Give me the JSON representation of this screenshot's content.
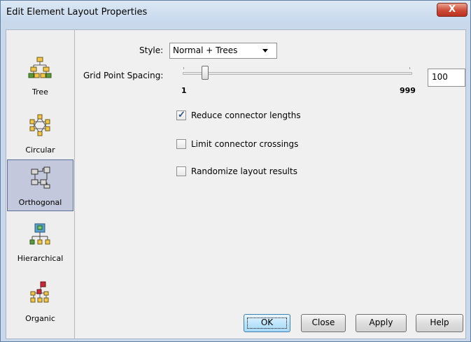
{
  "window": {
    "title": "Edit Element Layout Properties",
    "close_label": "X"
  },
  "sidebar": {
    "items": [
      {
        "label": "Tree",
        "icon": "tree-layout-icon"
      },
      {
        "label": "Circular",
        "icon": "circular-layout-icon"
      },
      {
        "label": "Orthogonal",
        "icon": "orthogonal-layout-icon",
        "selected": true
      },
      {
        "label": "Hierarchical",
        "icon": "hierarchical-layout-icon"
      },
      {
        "label": "Organic",
        "icon": "organic-layout-icon"
      }
    ]
  },
  "form": {
    "style_label": "Style:",
    "style_value": "Normal + Trees",
    "grid_label": "Grid Point Spacing:",
    "slider_min": "1",
    "slider_max": "999",
    "slider_value_fraction": 0.03,
    "grid_value": "100",
    "options": [
      {
        "label": "Reduce connector lengths",
        "checked": true
      },
      {
        "label": "Limit connector crossings",
        "checked": false
      },
      {
        "label": "Randomize layout results",
        "checked": false
      }
    ]
  },
  "buttons": {
    "ok": "OK",
    "close": "Close",
    "apply": "Apply",
    "help": "Help"
  },
  "colors": {
    "selected_bg": "#c4c8dc",
    "close_red": "#cc4a36",
    "checkmark": "#2d4f8a"
  }
}
